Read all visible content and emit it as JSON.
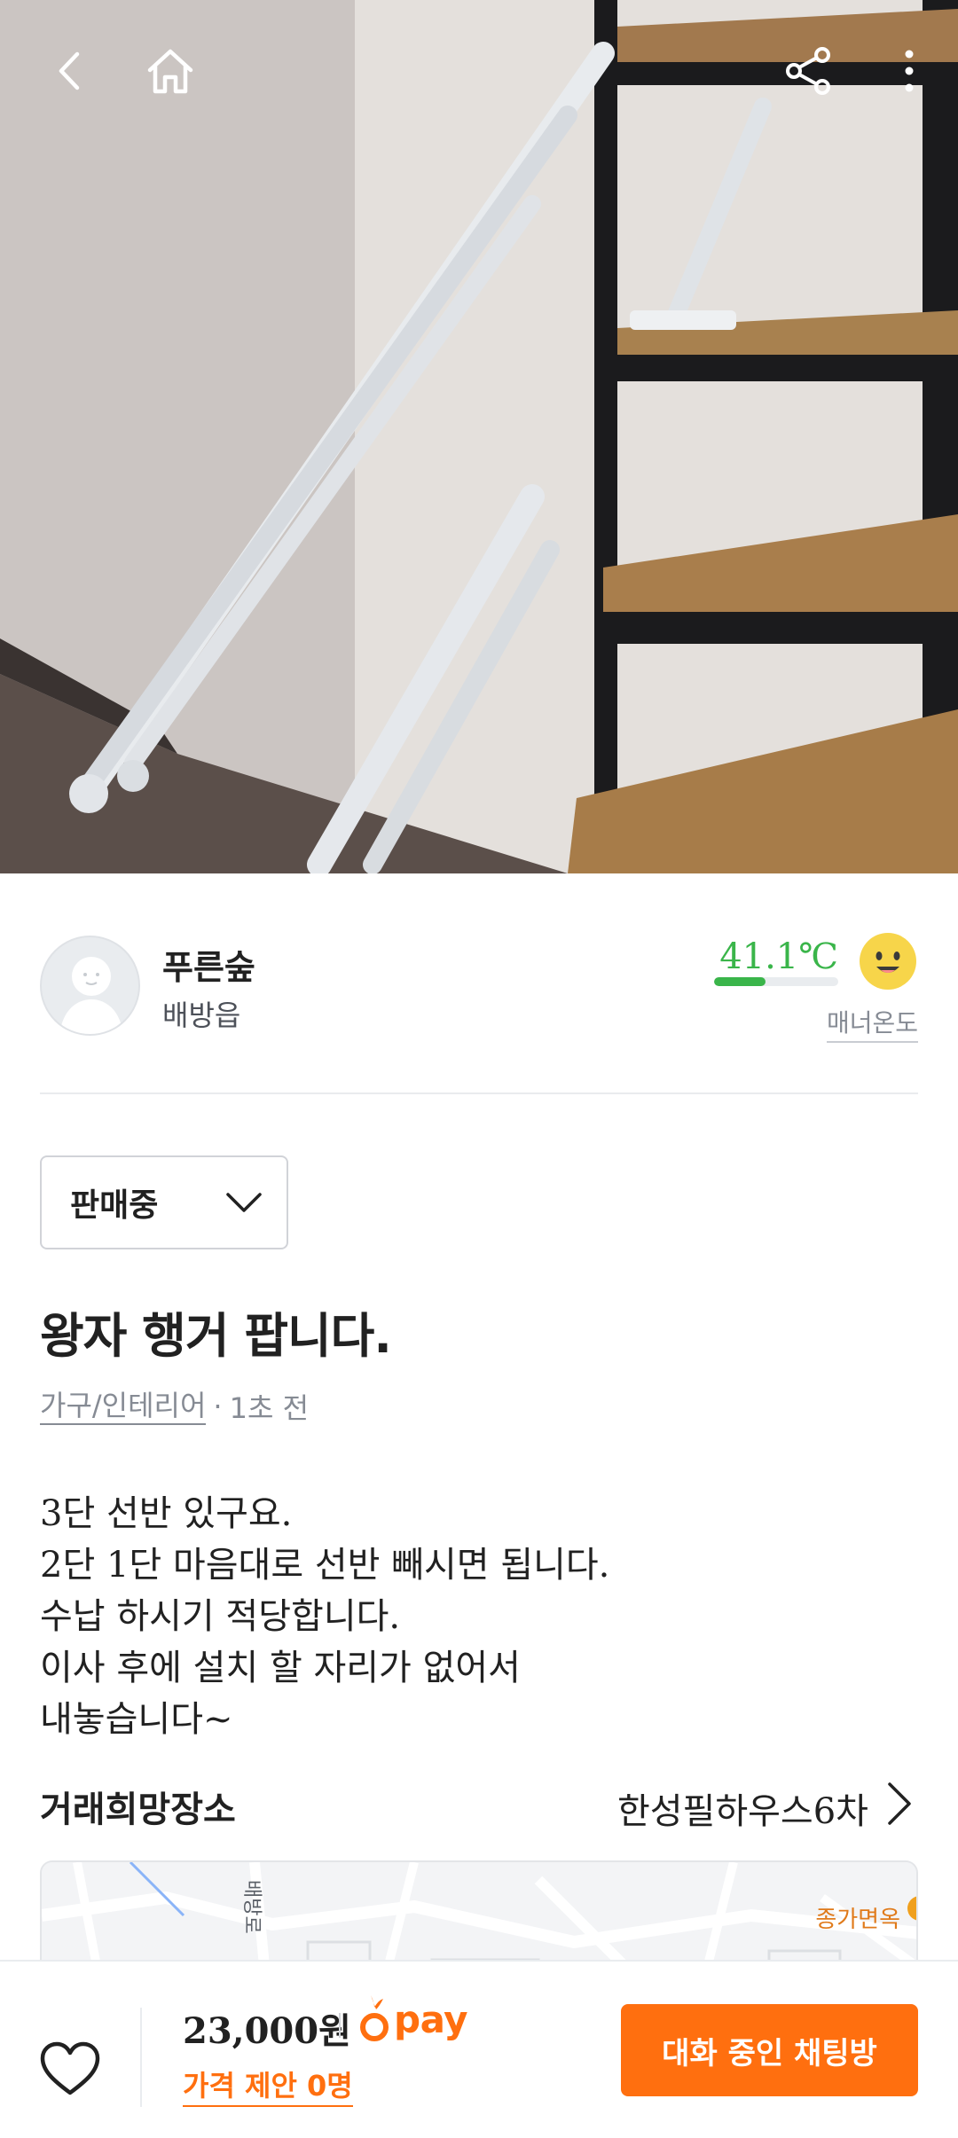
{
  "nav": {
    "back_icon": "chevron-left-icon",
    "home_icon": "home-icon",
    "share_icon": "share-icon",
    "more_icon": "more-vertical-icon"
  },
  "seller": {
    "name": "푸른숲",
    "location": "배방읍",
    "temperature": "41.1℃",
    "temperature_level": 0.411,
    "manner_label": "매너온도",
    "temperature_color": "#3ab54a"
  },
  "status": {
    "selected": "판매중"
  },
  "item": {
    "title": "왕자 행거 팝니다.",
    "category": "가구/인테리어",
    "separator": "·",
    "posted": "1초 전",
    "description": [
      "3단 선반 있구요.",
      "2단 1단 마음대로 선반 빼시면 됩니다.",
      "수납 하시기 적당합니다.",
      "이사 후에 설치 할 자리가 없어서",
      "내놓습니다~"
    ]
  },
  "trade": {
    "label": "거래희망장소",
    "place": "한성필하우스6차",
    "map_road_label": "배방로",
    "map_poi_label": "종가면옥"
  },
  "bottom": {
    "price": "23,000원",
    "pay_label": "pay",
    "offer": "가격 제안 0명",
    "chat_button": "대화 중인 채팅방",
    "accent_color": "#ff6f0f"
  }
}
